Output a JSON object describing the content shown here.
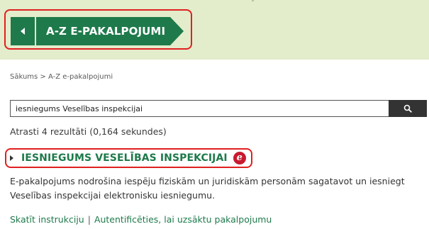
{
  "header": {
    "title": "A-Z E-PAKALPOJUMI",
    "back_icon": "chevron-left-icon",
    "background_color": "#e3eccb",
    "accent_color": "#1e7a4b",
    "highlight_color": "#e02020"
  },
  "breadcrumb": {
    "text": "Sākums > A-Z e-pakalpojumi"
  },
  "search": {
    "value": "iesniegums Veselības inspekcijai",
    "button_icon": "search-icon"
  },
  "results": {
    "summary": "Atrasti 4 rezultāti (0,164 sekundes)",
    "items": [
      {
        "title": "IESNIEGUMS VESELĪBAS INSPEKCIJAI",
        "badge_letter": "e",
        "badge_color": "#c81a2f",
        "description": "E-pakalpojums nodrošina iespēju fiziskām un juridiskām personām sagatavot un iesniegt Veselības inspekcijai elektronisku iesniegumu.",
        "link_instruction": "Skatīt instrukciju",
        "separator": "|",
        "link_auth": "Autentificēties, lai uzsāktu pakalpojumu"
      }
    ]
  }
}
